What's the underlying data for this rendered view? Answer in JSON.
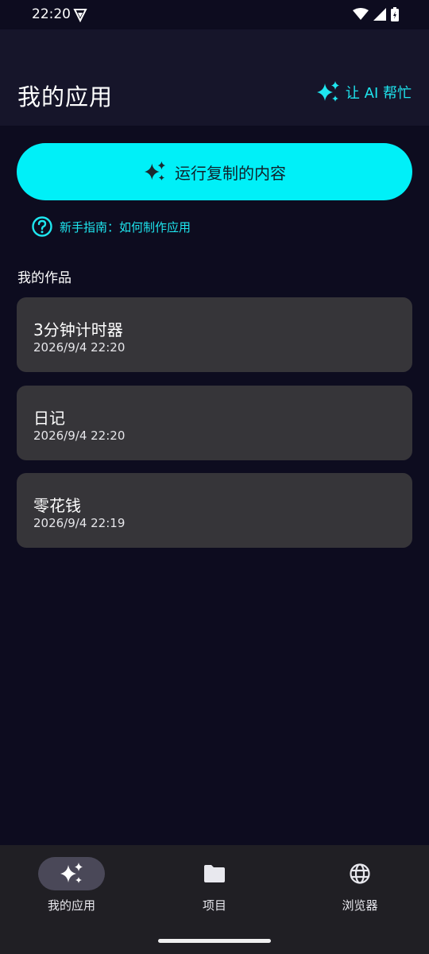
{
  "status_bar": {
    "time": "22:20",
    "icons": [
      "vpn-key-icon",
      "wifi-icon",
      "signal-icon",
      "battery-charging-icon"
    ]
  },
  "header": {
    "title": "我的应用",
    "ai_help_label": "让 AI 帮忙"
  },
  "actions": {
    "run_copied_label": "运行复制的内容",
    "guide_label": "新手指南：如何制作应用"
  },
  "works": {
    "section_title": "我的作品",
    "items": [
      {
        "title": "3分钟计时器",
        "date": "2026/9/4 22:20"
      },
      {
        "title": "日记",
        "date": "2026/9/4 22:20"
      },
      {
        "title": "零花钱",
        "date": "2026/9/4 22:19"
      }
    ]
  },
  "bottom_nav": {
    "items": [
      {
        "label": "我的应用",
        "icon": "sparkle-icon",
        "active": true
      },
      {
        "label": "项目",
        "icon": "folder-icon",
        "active": false
      },
      {
        "label": "浏览器",
        "icon": "globe-icon",
        "active": false
      }
    ]
  },
  "colors": {
    "background": "#0d0c1f",
    "app_bar": "#16152a",
    "accent": "#00f0f8",
    "accent_text": "#1ee6ef",
    "card": "#363539",
    "nav_bar": "#201f24",
    "nav_active_pill": "#4a4858"
  }
}
